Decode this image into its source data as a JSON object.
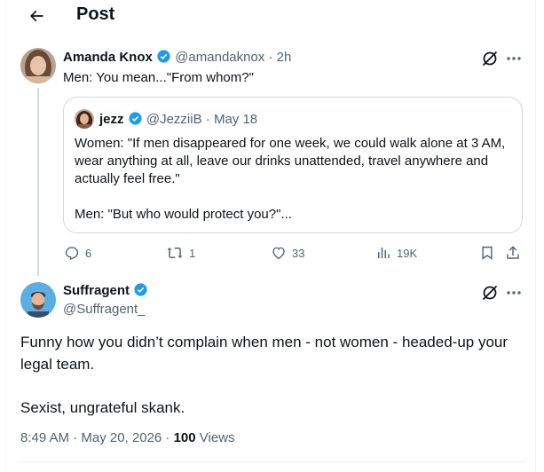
{
  "header": {
    "title": "Post"
  },
  "icons": {
    "back": "arrow-left-icon",
    "verified": "verified-badge-icon",
    "grok": "grok-icon",
    "more": "more-icon",
    "reply": "reply-icon",
    "repost": "repost-icon",
    "like": "heart-icon",
    "views": "views-icon",
    "bookmark": "bookmark-icon",
    "share": "share-icon"
  },
  "colors": {
    "verified": "#1d9bf0",
    "text": "#0f1419",
    "muted": "#536471",
    "border": "#cfd9de"
  },
  "parent_tweet": {
    "author_name": "Amanda Knox",
    "handle": "@amandaknox",
    "time": "· 2h",
    "text": "Men: You mean...\"From whom?\"",
    "quote": {
      "author_name": "jezz",
      "handle": "@JezziiB",
      "date": "· May 18",
      "paragraph1": "Women: \"If men disappeared for one week, we could walk alone at 3 AM, wear anything at all, leave our drinks unattended, travel anywhere and actually feel free.\"",
      "paragraph2": "Men: \"But who would protect you?\"..."
    },
    "actions": {
      "replies": "6",
      "reposts": "1",
      "likes": "33",
      "views": "19K"
    }
  },
  "main_tweet": {
    "author_name": "Suffragent",
    "handle": "@Suffragent_",
    "paragraph1": "Funny how you didn’t complain when men - not women - headed-up your legal team.",
    "paragraph2": "Sexist, ungrateful skank.",
    "time": "8:49 AM · May 20, 2026 · ",
    "views_count": "100",
    "views_label": " Views"
  }
}
